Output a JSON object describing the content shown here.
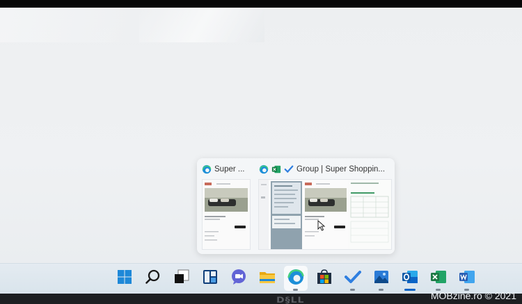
{
  "watermark": "MOBzine.ro © 2021",
  "bezel_logo": "D§LL",
  "taskbar_preview": {
    "cards": [
      {
        "title": "Super ...",
        "app_icons": [
          "edge-icon"
        ],
        "thumbnail": "shopping-site-page-with-sofa-photo"
      },
      {
        "title": "Group | Super Shoppin...",
        "app_icons": [
          "edge-icon",
          "excel-icon",
          "todo-icon"
        ],
        "thumbnails": [
          "list-app-pane",
          "shopping-site-page-with-sofa-photo",
          "spreadsheet-pane"
        ]
      }
    ]
  },
  "taskbar": {
    "icons": [
      {
        "name": "start-icon",
        "running": false
      },
      {
        "name": "search-icon",
        "running": false
      },
      {
        "name": "task-view-icon",
        "running": false
      },
      {
        "name": "widgets-icon",
        "running": false
      },
      {
        "name": "teams-chat-icon",
        "running": false
      },
      {
        "name": "file-explorer-icon",
        "running": false
      },
      {
        "name": "edge-icon",
        "running": true,
        "hovered": true
      },
      {
        "name": "store-icon",
        "running": false
      },
      {
        "name": "todo-icon",
        "running": true
      },
      {
        "name": "photos-icon",
        "running": true
      },
      {
        "name": "outlook-icon",
        "running": true,
        "active": true
      },
      {
        "name": "excel-icon",
        "running": true
      },
      {
        "name": "word-icon",
        "running": true
      }
    ]
  },
  "colors": {
    "desktop_bg": "#eef0f2",
    "taskbar_bg": "#dfe8ef",
    "accent": "#0a64c6",
    "edge_blue": "#1c8fd8",
    "excel_green": "#1d7a45",
    "word_blue": "#2b5fb3"
  }
}
